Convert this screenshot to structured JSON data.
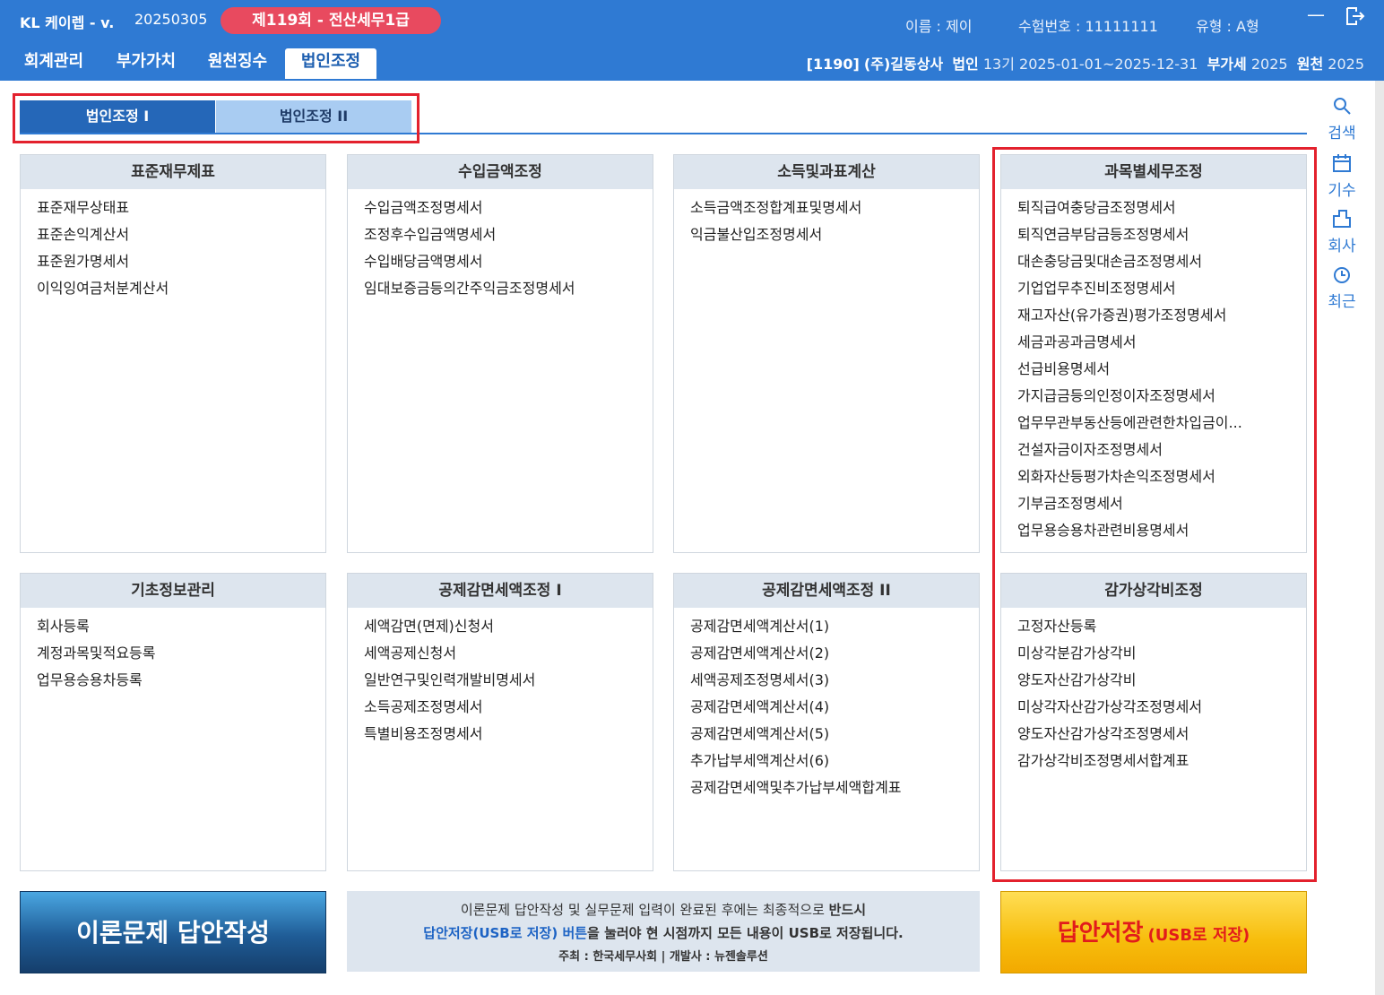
{
  "header": {
    "logo": "KL 케이렙",
    "version": "- v.",
    "build": "20250305",
    "exam": "제119회 - 전산세무1급",
    "user": {
      "name_label": "이름 : 제이",
      "exam_no_label": "수험번호 : 11111111",
      "type_label": "유형 : A형"
    },
    "menu": [
      "회계관리",
      "부가가치",
      "원천징수",
      "법인조정"
    ],
    "active_menu": "법인조정",
    "company": {
      "code": "[1190]",
      "name": "(주)길동상사",
      "corp_label": "법인",
      "period": "13기 2025-01-01~2025-12-31",
      "vat_label": "부가세",
      "vat_year": "2025",
      "wh_label": "원천",
      "wh_year": "2025"
    }
  },
  "subtabs": [
    "법인조정 I",
    "법인조정 II"
  ],
  "sidebar": [
    {
      "label": "검색",
      "icon": "search-icon"
    },
    {
      "label": "기수",
      "icon": "calendar-icon"
    },
    {
      "label": "회사",
      "icon": "building-icon"
    },
    {
      "label": "최근",
      "icon": "recent-icon"
    }
  ],
  "panels": [
    {
      "title": "표준재무제표",
      "items": [
        "표준재무상태표",
        "표준손익계산서",
        "표준원가명세서",
        "이익잉여금처분계산서"
      ]
    },
    {
      "title": "수입금액조정",
      "items": [
        "수입금액조정명세서",
        "조정후수입금액명세서",
        "수입배당금액명세서",
        "임대보증금등의간주익금조정명세서"
      ]
    },
    {
      "title": "소득및과표계산",
      "items": [
        "소득금액조정합계표및명세서",
        "익금불산입조정명세서"
      ]
    },
    {
      "title": "과목별세무조정",
      "items": [
        "퇴직급여충당금조정명세서",
        "퇴직연금부담금등조정명세서",
        "대손충당금및대손금조정명세서",
        "기업업무추진비조정명세서",
        "재고자산(유가증권)평가조정명세서",
        "세금과공과금명세서",
        "선급비용명세서",
        "가지급금등의인정이자조정명세서",
        "업무무관부동산등에관련한차입금이...",
        "건설자금이자조정명세서",
        "외화자산등평가차손익조정명세서",
        "기부금조정명세서",
        "업무용승용차관련비용명세서"
      ]
    },
    {
      "title": "기초정보관리",
      "items": [
        "회사등록",
        "계정과목및적요등록",
        "업무용승용차등록"
      ]
    },
    {
      "title": "공제감면세액조정 I",
      "items": [
        "세액감면(면제)신청서",
        "세액공제신청서",
        "일반연구및인력개발비명세서",
        "소득공제조정명세서",
        "특별비용조정명세서"
      ]
    },
    {
      "title": "공제감면세액조정 II",
      "items": [
        "공제감면세액계산서(1)",
        "공제감면세액계산서(2)",
        "세액공제조정명세서(3)",
        "공제감면세액계산서(4)",
        "공제감면세액계산서(5)",
        "추가납부세액계산서(6)",
        "공제감면세액및추가납부세액합계표"
      ]
    },
    {
      "title": "감가상각비조정",
      "items": [
        "고정자산등록",
        "미상각분감가상각비",
        "양도자산감가상각비",
        "미상각자산감가상각조정명세서",
        "양도자산감가상각조정명세서",
        "감가상각비조정명세서합계표"
      ]
    }
  ],
  "bottom": {
    "theory_button": "이론문제 답안작성",
    "notice_line1": "이론문제 답안작성 및 실무문제 입력이 완료된 후에는 최종적으로",
    "notice_line1_bold": "반드시",
    "notice_line2_blue": "답안저장(USB로 저장) 버튼",
    "notice_line2": "을 눌러야 현 시점까지 모든 내용이 USB로 저장됩니다.",
    "notice_line3": "주최 : 한국세무사회  |  개발사 : 뉴젠솔루션",
    "save_main": "답안저장",
    "save_sub": "(USB로 저장)"
  }
}
